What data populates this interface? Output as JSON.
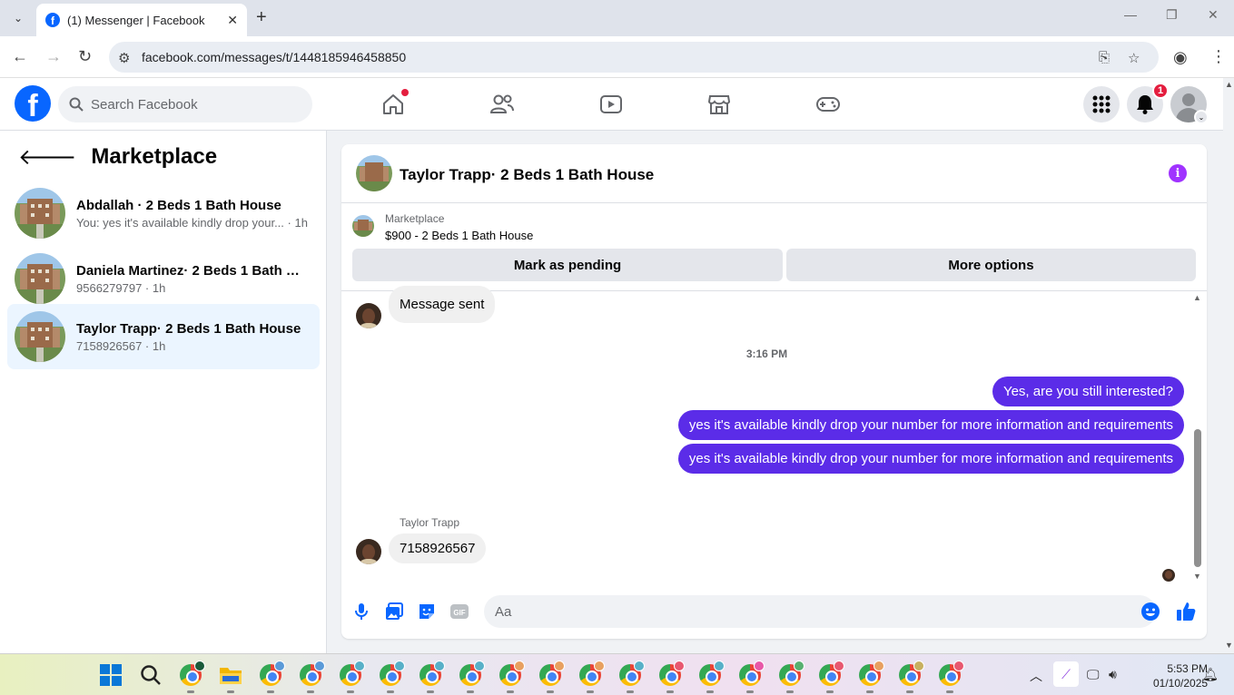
{
  "browser": {
    "tab_title": "(1) Messenger | Facebook",
    "url": "facebook.com/messages/t/1448185946458850"
  },
  "fb_nav": {
    "search_placeholder": "Search Facebook",
    "notification_count": "1",
    "icons": [
      "home-icon",
      "friends-icon",
      "video-icon",
      "marketplace-icon",
      "gaming-icon",
      "menu-grid-icon",
      "bell-icon"
    ]
  },
  "sidebar": {
    "title": "Marketplace",
    "conversations": [
      {
        "name": "Abdallah · 2 Beds 1 Bath House",
        "preview": "You: yes it's available kindly drop your... · 1h"
      },
      {
        "name": "Daniela Martinez· 2 Beds 1 Bath H...",
        "preview": "9566279797 · 1h"
      },
      {
        "name": "Taylor Trapp· 2 Beds 1 Bath House",
        "preview": "7158926567 · 1h"
      }
    ]
  },
  "chat": {
    "title": "Taylor Trapp· 2 Beds 1 Bath House",
    "marketplace_label": "Marketplace",
    "listing": "$900 - 2 Beds 1 Bath House",
    "mark_pending": "Mark as pending",
    "more_options": "More options",
    "messages": {
      "m0": "Message sent",
      "timestamp": "3:16 PM",
      "m1": "Yes, are you still interested?",
      "m2": "yes it's available kindly drop your number for more information and requirements",
      "m3": "yes it's available kindly drop your number for more information and requirements",
      "sender": "Taylor Trapp",
      "m4": "7158926567"
    },
    "composer_placeholder": "Aa"
  },
  "colors": {
    "fb_blue": "#0866ff",
    "outgoing_bubble": "#5b2ce8",
    "active_conv": "#ebf5ff",
    "badge_red": "#e41e3f"
  },
  "taskbar": {
    "time": "5:53 PM",
    "date": "01/10/2025"
  }
}
